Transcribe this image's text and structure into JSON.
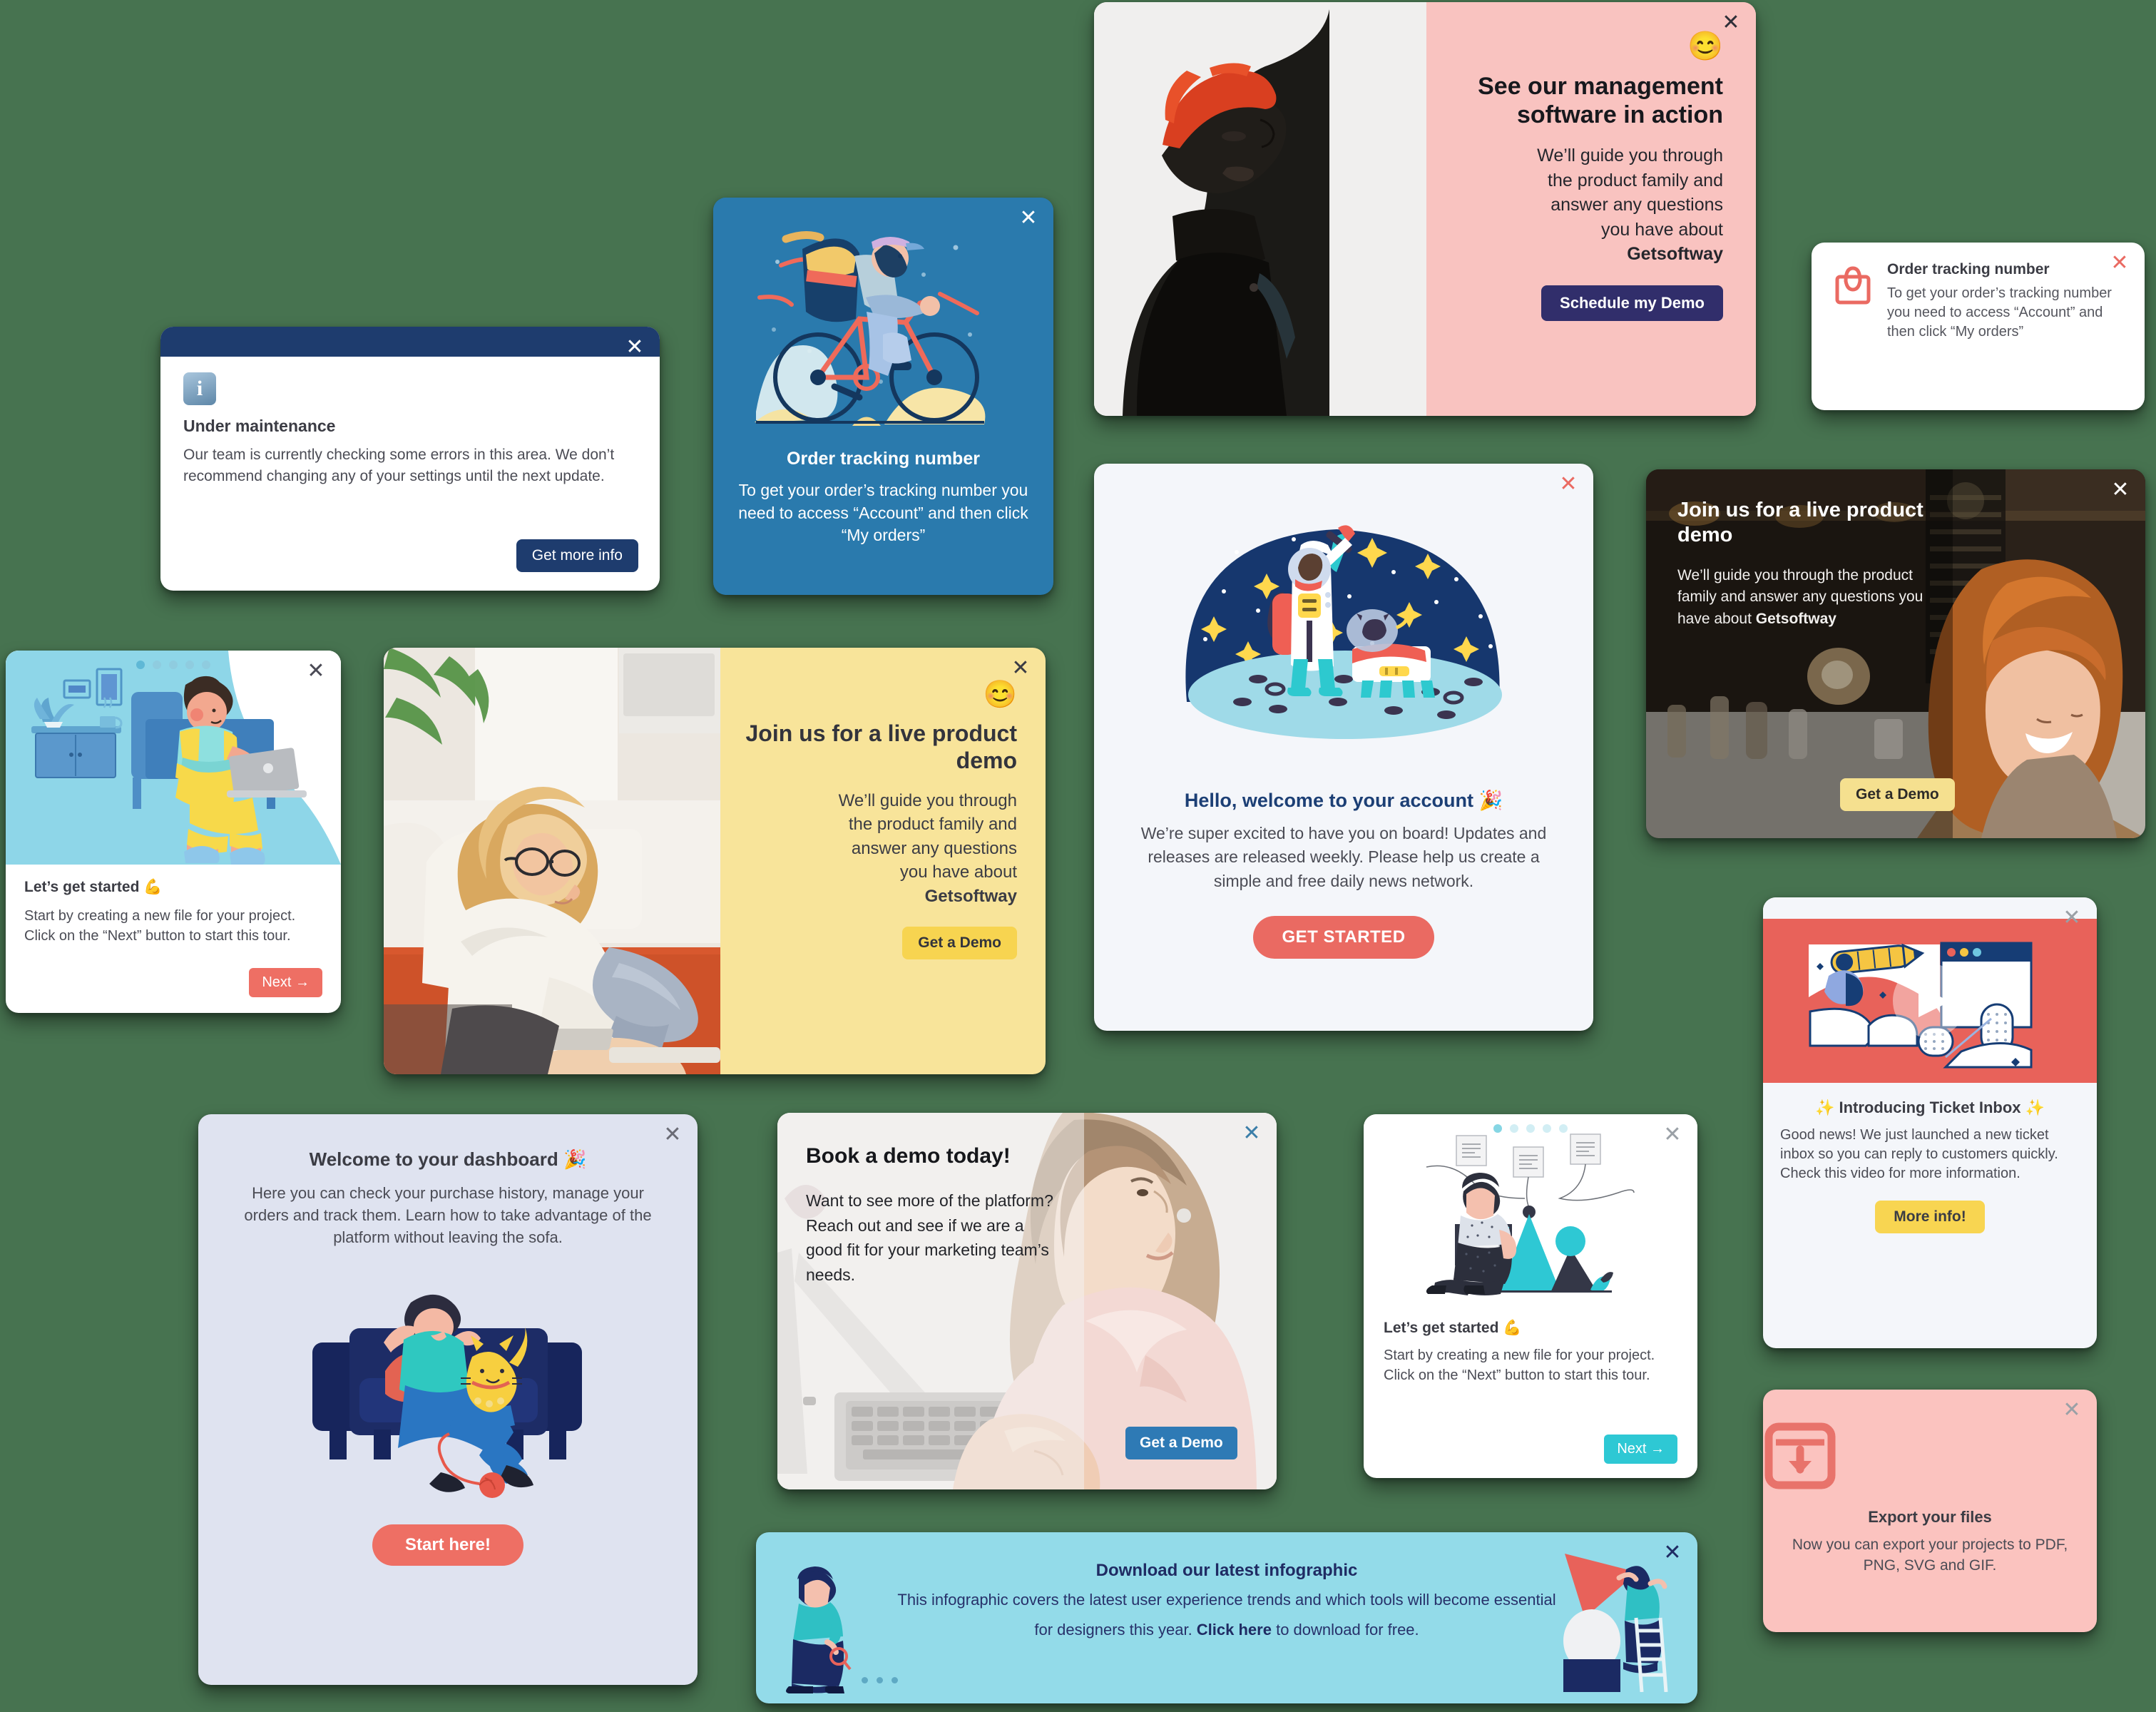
{
  "background_color": "#477350",
  "cards": {
    "maintenance": {
      "title": "Under maintenance",
      "body": "Our team is currently checking some errors in this area. We don’t recommend changing any of your settings until the next update.",
      "button": "Get more info",
      "close": "✕",
      "icon": "info-icon",
      "titlebar_color": "#1e3c6e",
      "button_color": "#1e3c6e"
    },
    "bike_tracking": {
      "title": "Order tracking number",
      "body": "To get your order’s tracking number you need to access “Account” and then click “My orders”",
      "close": "✕",
      "bg_color": "#2a7aad"
    },
    "management_software": {
      "emoji": "😊",
      "title": "See our management software in action",
      "body_line1": "We’ll guide you through",
      "body_line2": "the product family and",
      "body_line3": "answer any questions",
      "body_line4": "you have about",
      "brand": "Getsoftway",
      "button": "Schedule my Demo",
      "close": "✕",
      "pane_color": "#f9c3c0",
      "button_color": "#312e6b"
    },
    "order_tracking_small": {
      "title": "Order tracking number",
      "body": "To get your order’s tracking number you need to access “Account” and then click “My orders”",
      "close": "✕",
      "icon": "shopping-bag-icon",
      "accent_color": "#ea6a62"
    },
    "astronaut_welcome": {
      "title": "Hello, welcome to your account 🎉",
      "body": "We’re super excited to have you on board! Updates and releases are released weekly. Please help us create a simple and free daily news network.",
      "button": "GET STARTED",
      "close": "✕",
      "bg_color": "#f4f6fa",
      "button_color": "#ea6a62"
    },
    "live_demo_dark": {
      "title": "Join us for a live product demo",
      "body_prefix": "We’ll guide you through the product family and answer any questions you have about",
      "brand": "Getsoftway",
      "button": "Get a Demo",
      "close": "✕",
      "button_color": "#f5e08f"
    },
    "get_started_blue": {
      "title": "Let’s get started 💪",
      "body": "Start by creating a new file for your project. Click on the “Next” button to start this tour.",
      "button": "Next  →",
      "close": "✕",
      "dots_total": 5,
      "dots_active": 0,
      "button_color": "#ee6f64",
      "illustration_bg": "#8ed6e8"
    },
    "live_demo_yellow": {
      "emoji": "😊",
      "title": "Join us for a live product demo",
      "body_line1": "We’ll guide you through",
      "body_line2": "the product family and",
      "body_line3": "answer any questions",
      "body_line4": "you have about",
      "brand": "Getsoftway",
      "button": "Get a Demo",
      "close": "✕",
      "pane_color": "#f8e49a",
      "button_color": "#f7d450"
    },
    "welcome_dashboard": {
      "title": "Welcome to your dashboard 🎉",
      "body": "Here you can check your purchase history, manage your orders and track them. Learn how to take advantage of the platform without leaving the sofa.",
      "button": "Start here!",
      "close": "✕",
      "bg_color": "#dfe3f0",
      "button_color": "#ee6f64"
    },
    "book_demo": {
      "title": "Book a demo today!",
      "body": "Want to see more of the platform? Reach out and see if we are a good fit for your marketing team’s needs.",
      "button": "Get a Demo",
      "close": "✕",
      "button_color": "#2e7ab5"
    },
    "get_started_teal": {
      "title": "Let’s get started 💪",
      "body": "Start by creating a new file for your project. Click on the “Next” button to start this tour.",
      "button": "Next  →",
      "close": "✕",
      "dots_total": 5,
      "dots_active": 0,
      "button_color": "#2ec8d4"
    },
    "ticket_inbox": {
      "title": "✨ Introducing Ticket Inbox ✨",
      "body": "Good news! We just launched a new ticket inbox so you can reply to customers quickly. Check this video for more information.",
      "button": "More info!",
      "close": "✕",
      "banner_color": "#e8625a",
      "button_color": "#f8d551"
    },
    "export_files": {
      "title": "Export your files",
      "body": "Now you can export your projects to PDF, PNG, SVG and GIF.",
      "close": "✕",
      "icon": "download-box-icon",
      "bg_color": "#fbc3bf",
      "accent_color": "#e8736b"
    },
    "infographic_banner": {
      "title": "Download our latest infographic",
      "body_part1": "This infographic covers the latest user experience trends and which tools will become essential for designers this year. ",
      "link": "Click here",
      "body_part2": " to download for free.",
      "close": "✕",
      "bg_color": "#93dbe9",
      "dots_total": 3
    }
  }
}
